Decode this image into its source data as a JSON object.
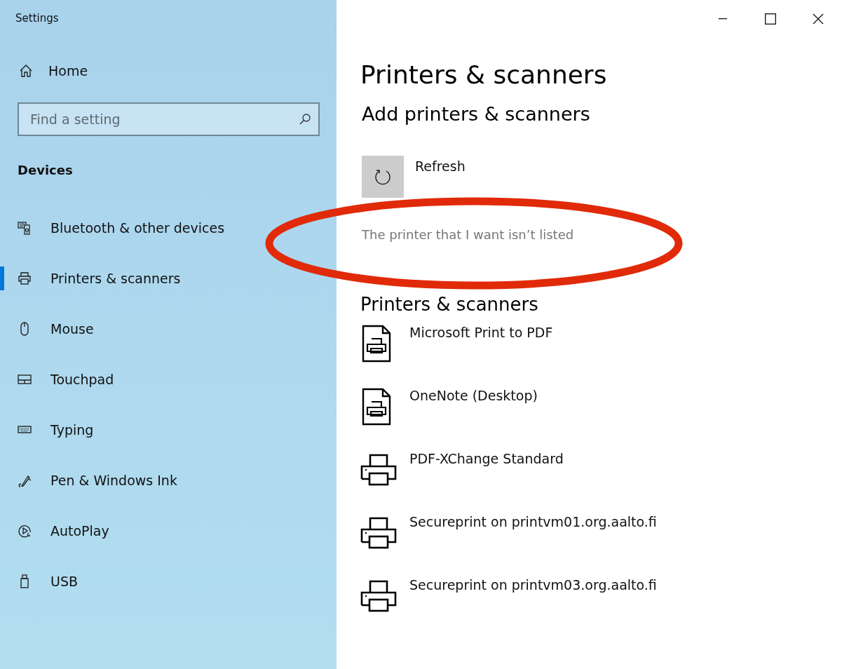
{
  "window": {
    "title": "Settings"
  },
  "sidebar": {
    "home": "Home",
    "search": {
      "placeholder": "Find a setting"
    },
    "section": "Devices",
    "items": [
      {
        "label": "Bluetooth & other devices",
        "selected": false
      },
      {
        "label": "Printers & scanners",
        "selected": true
      },
      {
        "label": "Mouse",
        "selected": false
      },
      {
        "label": "Touchpad",
        "selected": false
      },
      {
        "label": "Typing",
        "selected": false
      },
      {
        "label": "Pen & Windows Ink",
        "selected": false
      },
      {
        "label": "AutoPlay",
        "selected": false
      },
      {
        "label": "USB",
        "selected": false
      }
    ]
  },
  "main": {
    "title": "Printers & scanners",
    "add_heading": "Add printers & scanners",
    "refresh": "Refresh",
    "not_listed_link": "The printer that I want isn’t listed",
    "list_heading": "Printers & scanners",
    "printers": [
      {
        "name": "Microsoft Print to PDF",
        "kind": "file"
      },
      {
        "name": "OneNote (Desktop)",
        "kind": "file"
      },
      {
        "name": "PDF-XChange Standard",
        "kind": "device"
      },
      {
        "name": "Secureprint on printvm01.org.aalto.fi",
        "kind": "device"
      },
      {
        "name": "Secureprint on printvm03.org.aalto.fi",
        "kind": "device"
      }
    ]
  }
}
